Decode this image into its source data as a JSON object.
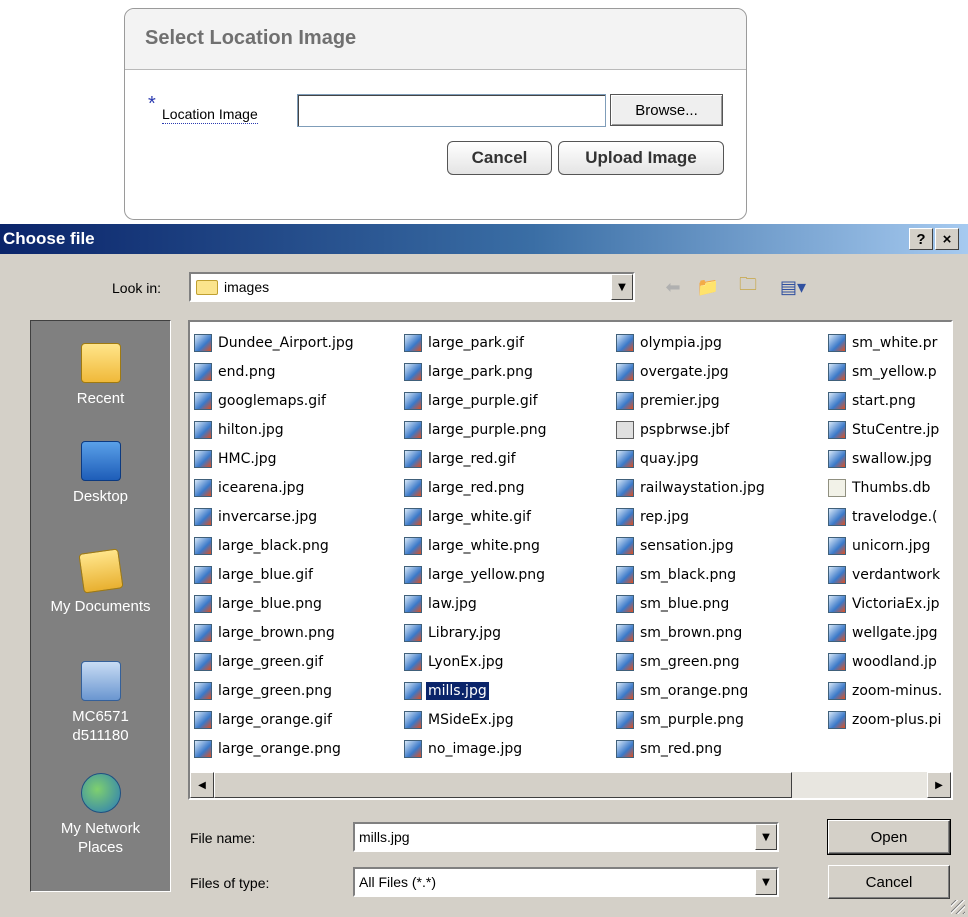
{
  "upload": {
    "title": "Select Location Image",
    "required_marker": "*",
    "field_label": "Location Image",
    "field_value": "",
    "browse_label": "Browse...",
    "cancel_label": "Cancel",
    "upload_label": "Upload Image"
  },
  "dialog": {
    "title": "Choose file",
    "help_label": "?",
    "close_label": "×",
    "look_in_label": "Look in:",
    "look_in_value": "images",
    "places": [
      "Recent",
      "Desktop",
      "My Documents",
      "MC6571\nd511180",
      "My Network\nPlaces"
    ],
    "columns": [
      [
        "Dundee_Airport.jpg",
        "end.png",
        "googlemaps.gif",
        "hilton.jpg",
        "HMC.jpg",
        "icearena.jpg",
        "invercarse.jpg",
        "large_black.png",
        "large_blue.gif",
        "large_blue.png",
        "large_brown.png",
        "large_green.gif",
        "large_green.png",
        "large_orange.gif",
        "large_orange.png"
      ],
      [
        "large_park.gif",
        "large_park.png",
        "large_purple.gif",
        "large_purple.png",
        "large_red.gif",
        "large_red.png",
        "large_white.gif",
        "large_white.png",
        "large_yellow.png",
        "law.jpg",
        "Library.jpg",
        "LyonEx.jpg",
        "mills.jpg",
        "MSideEx.jpg",
        "no_image.jpg"
      ],
      [
        "olympia.jpg",
        "overgate.jpg",
        "premier.jpg",
        "pspbrwse.jbf",
        "quay.jpg",
        "railwaystation.jpg",
        "rep.jpg",
        "sensation.jpg",
        "sm_black.png",
        "sm_blue.png",
        "sm_brown.png",
        "sm_green.png",
        "sm_orange.png",
        "sm_purple.png",
        "sm_red.png"
      ],
      [
        "sm_white.pr",
        "sm_yellow.p",
        "start.png",
        "StuCentre.jp",
        "swallow.jpg",
        "Thumbs.db",
        "travelodge.(",
        "unicorn.jpg",
        "verdantwork",
        "VictoriaEx.jp",
        "wellgate.jpg",
        "woodland.jp",
        "zoom-minus.",
        "zoom-plus.pi"
      ]
    ],
    "selected_file": "mills.jpg",
    "file_name_label": "File name:",
    "file_name_value": "mills.jpg",
    "file_type_label": "Files of type:",
    "file_type_value": "All Files (*.*)",
    "open_label": "Open",
    "cancel_label": "Cancel"
  }
}
